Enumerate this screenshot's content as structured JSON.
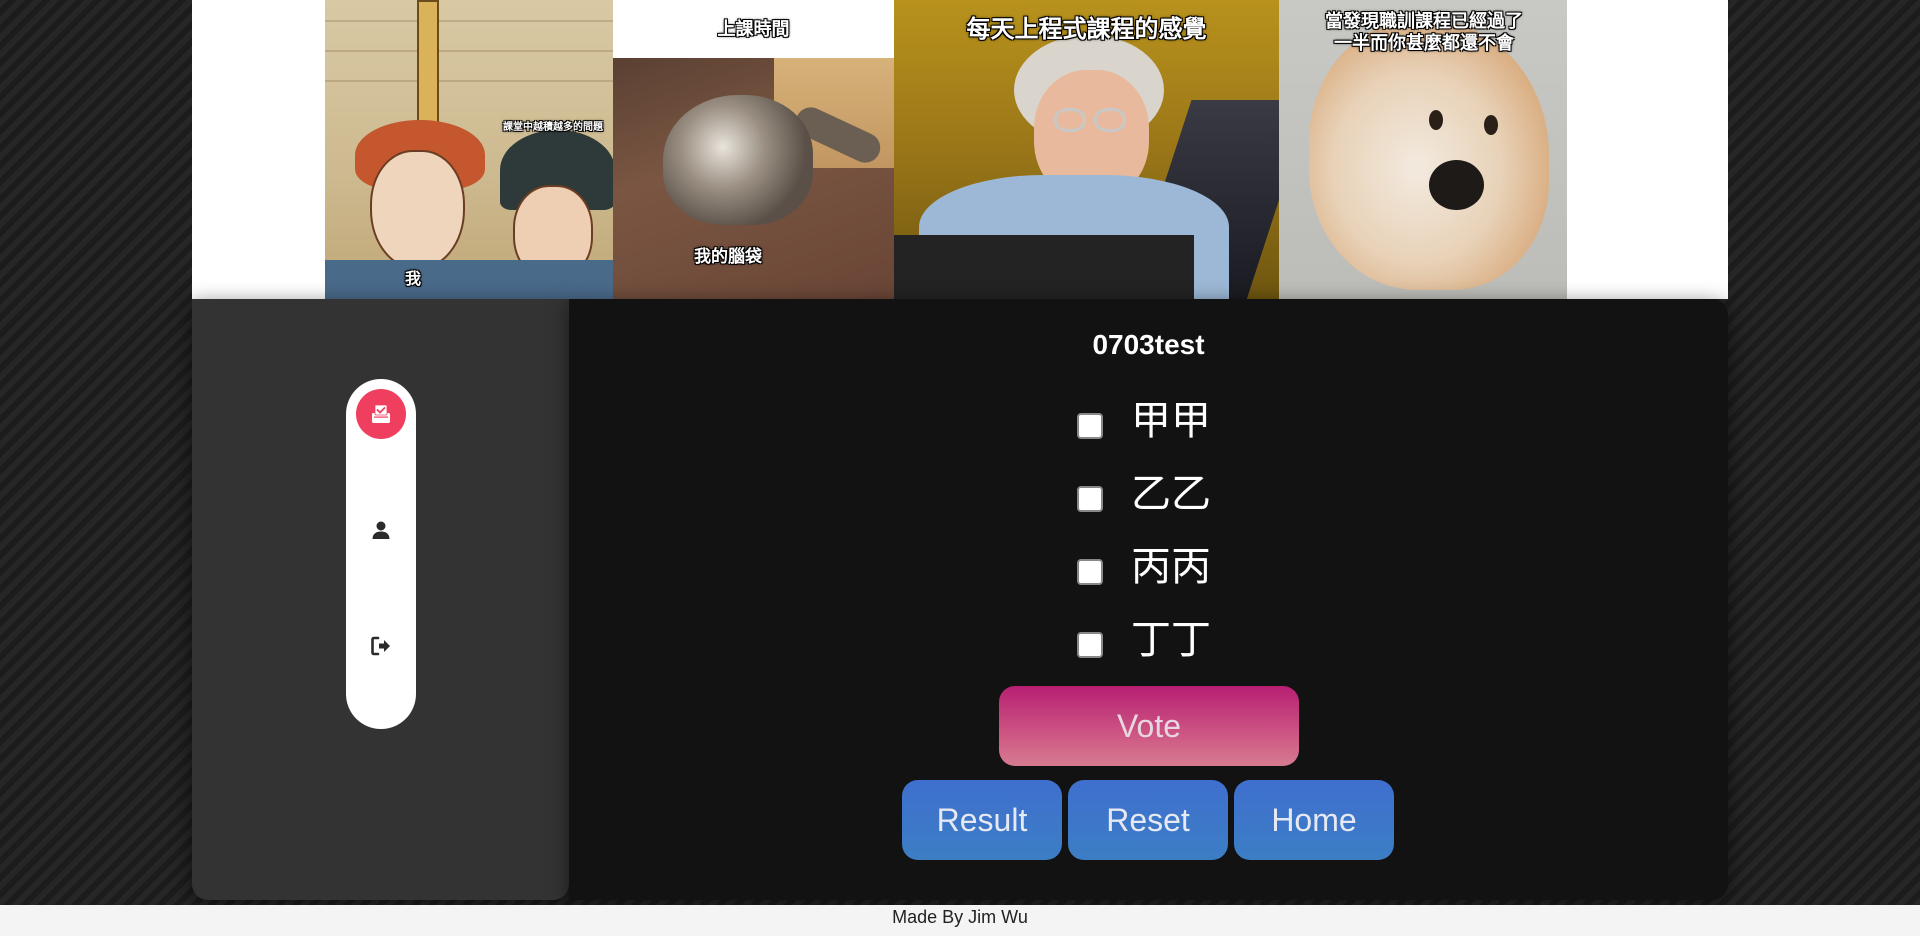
{
  "banner": {
    "memes": [
      {
        "icon": "medieval-meme-image",
        "captions": [
          "課堂中越積越多的問題",
          "我"
        ]
      },
      {
        "icon": "cat-meme-image",
        "captions": [
          "上課時間",
          "我的腦袋"
        ]
      },
      {
        "icon": "grandma-computer-meme-image",
        "captions": [
          "每天上程式課程的感覺"
        ]
      },
      {
        "icon": "doge-meme-image",
        "captions": [
          "當發現職訓課程已經過了",
          "一半而你甚麼都還不會"
        ]
      }
    ]
  },
  "sidebar": {
    "items": [
      {
        "icon": "vote-box-icon",
        "active": true
      },
      {
        "icon": "user-icon",
        "active": false
      },
      {
        "icon": "logout-icon",
        "active": false
      }
    ]
  },
  "poll": {
    "title": "0703test",
    "options": [
      {
        "label": "甲甲",
        "checked": false
      },
      {
        "label": "乙乙",
        "checked": false
      },
      {
        "label": "丙丙",
        "checked": false
      },
      {
        "label": "丁丁",
        "checked": false
      }
    ],
    "vote_label": "Vote",
    "result_label": "Result",
    "reset_label": "Reset",
    "home_label": "Home"
  },
  "footer": {
    "text": "Made By Jim Wu"
  },
  "colors": {
    "accent_active": "#f03e5e",
    "vote_gradient_top": "#b71f72",
    "action_blue": "#3f6fcf"
  }
}
